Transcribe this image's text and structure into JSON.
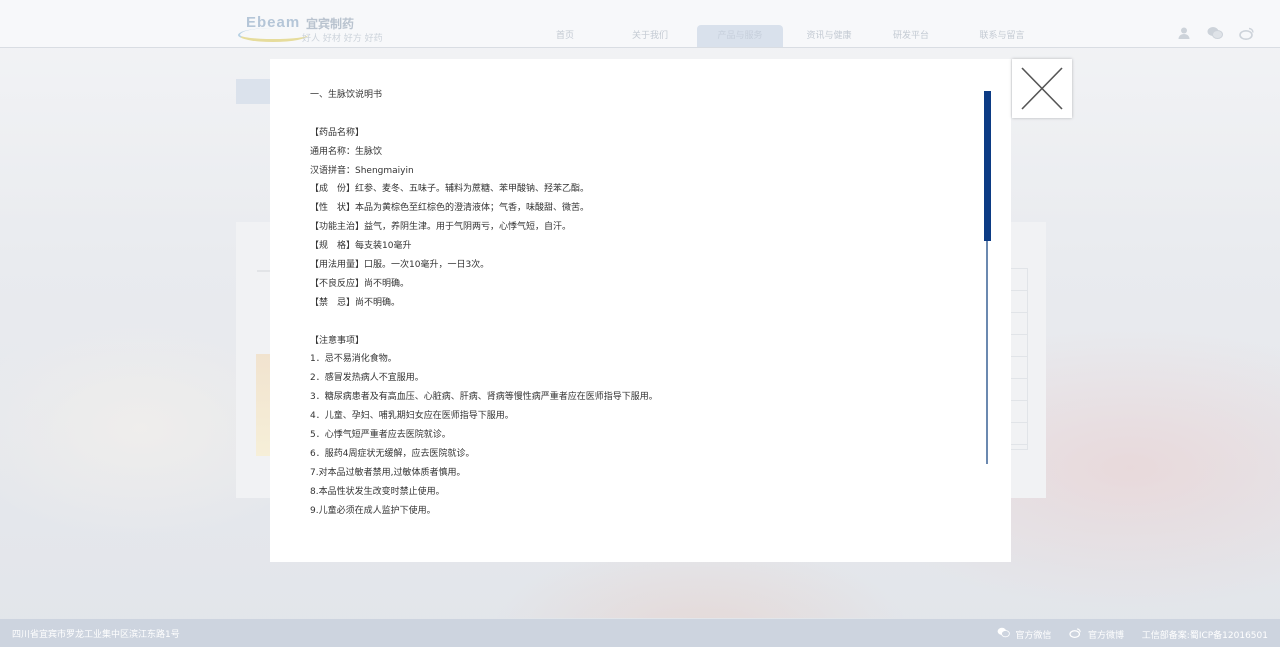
{
  "header": {
    "logo_en": "Ebeam",
    "logo_cn": "宜宾制药",
    "logo_slogan": "好人 好材 好方 好药",
    "nav": [
      {
        "label": "首页"
      },
      {
        "label": "关于我们"
      },
      {
        "label": "产品与服务"
      },
      {
        "label": "资讯与健康"
      },
      {
        "label": "研发平台"
      },
      {
        "label": "联系与留言"
      }
    ],
    "icons": [
      "user-icon",
      "wechat-icon",
      "weibo-icon"
    ]
  },
  "modal": {
    "lines": [
      "一、生脉饮说明书",
      "",
      "【药品名称】",
      "通用名称：生脉饮",
      "汉语拼音：Shengmaiyin",
      "【成　份】红参、麦冬、五味子。辅料为蔗糖、苯甲酸钠、羟苯乙酯。",
      "【性　状】本品为黄棕色至红棕色的澄清液体；气香，味酸甜、微苦。",
      "【功能主治】益气，养阴生津。用于气阴两亏，心悸气短，自汗。",
      "【规　格】每支装10毫升",
      "【用法用量】口服。一次10毫升，一日3次。",
      "【不良反应】尚不明确。",
      "【禁　忌】尚不明确。",
      "",
      "【注意事项】",
      "1．忌不易消化食物。",
      "2．感冒发热病人不宜服用。",
      "3．糖尿病患者及有高血压、心脏病、肝病、肾病等慢性病严重者应在医师指导下服用。",
      "4．儿童、孕妇、哺乳期妇女应在医师指导下服用。",
      "5．心悸气短严重者应去医院就诊。",
      "6．服药4周症状无缓解，应去医院就诊。",
      "7.对本品过敏者禁用,过敏体质者慎用。",
      "8.本品性状发生改变时禁止使用。",
      "9.儿童必须在成人监护下使用。"
    ],
    "close_icon": "close-icon",
    "colors": {
      "scroll_thumb": "#0c3b84",
      "scroll_track": "#6b89b0"
    }
  },
  "footer": {
    "address": "四川省宜宾市罗龙工业集中区滨江东路1号",
    "wechat_label": "官方微信",
    "weibo_label": "官方微博",
    "icp": "工信部备案:蜀ICP备12016501"
  }
}
